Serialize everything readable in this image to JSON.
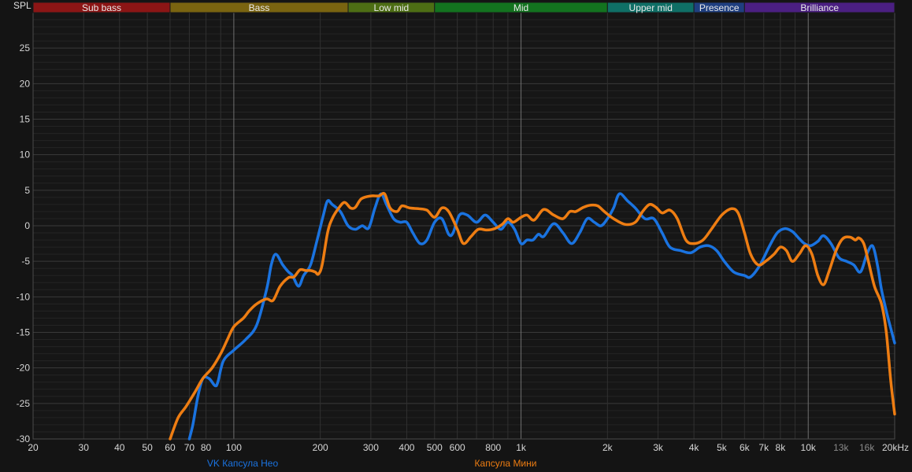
{
  "chart_data": {
    "type": "line",
    "ylabel": "SPL",
    "x_scale": "log",
    "xlim": [
      20,
      20000
    ],
    "ylim": [
      -30,
      30
    ],
    "x_ticks": [
      {
        "v": 20,
        "label": "20"
      },
      {
        "v": 30,
        "label": "30"
      },
      {
        "v": 40,
        "label": "40"
      },
      {
        "v": 50,
        "label": "50"
      },
      {
        "v": 60,
        "label": "60"
      },
      {
        "v": 70,
        "label": "70"
      },
      {
        "v": 80,
        "label": "80"
      },
      {
        "v": 100,
        "label": "100"
      },
      {
        "v": 200,
        "label": "200"
      },
      {
        "v": 300,
        "label": "300"
      },
      {
        "v": 400,
        "label": "400"
      },
      {
        "v": 500,
        "label": "500"
      },
      {
        "v": 600,
        "label": "600"
      },
      {
        "v": 800,
        "label": "800"
      },
      {
        "v": 1000,
        "label": "1k"
      },
      {
        "v": 2000,
        "label": "2k"
      },
      {
        "v": 3000,
        "label": "3k"
      },
      {
        "v": 4000,
        "label": "4k"
      },
      {
        "v": 5000,
        "label": "5k"
      },
      {
        "v": 6000,
        "label": "6k"
      },
      {
        "v": 7000,
        "label": "7k"
      },
      {
        "v": 8000,
        "label": "8k"
      },
      {
        "v": 10000,
        "label": "10k"
      },
      {
        "v": 13000,
        "label": "13k",
        "dim": true
      },
      {
        "v": 16000,
        "label": "16k",
        "dim": true
      },
      {
        "v": 20000,
        "label": "20kHz"
      }
    ],
    "y_ticks": [
      {
        "v": 25,
        "label": "25"
      },
      {
        "v": 20,
        "label": "20"
      },
      {
        "v": 15,
        "label": "15"
      },
      {
        "v": 10,
        "label": "10"
      },
      {
        "v": 5,
        "label": "5"
      },
      {
        "v": 0,
        "label": "0"
      },
      {
        "v": -5,
        "label": "-5"
      },
      {
        "v": -10,
        "label": "-10"
      },
      {
        "v": -15,
        "label": "-15"
      },
      {
        "v": -20,
        "label": "-20"
      },
      {
        "v": -25,
        "label": "-25"
      },
      {
        "v": -30,
        "label": "-30"
      }
    ],
    "bands": [
      {
        "name": "Sub bass",
        "from": 20,
        "to": 60,
        "color": "#8c1515"
      },
      {
        "name": "Bass",
        "from": 60,
        "to": 250,
        "color": "#7a6410"
      },
      {
        "name": "Low mid",
        "from": 250,
        "to": 500,
        "color": "#4d6e14"
      },
      {
        "name": "Mid",
        "from": 500,
        "to": 2000,
        "color": "#13731f"
      },
      {
        "name": "Upper mid",
        "from": 2000,
        "to": 4000,
        "color": "#0f6f66"
      },
      {
        "name": "Presence",
        "from": 4000,
        "to": 6000,
        "color": "#1f3f80"
      },
      {
        "name": "Brilliance",
        "from": 6000,
        "to": 20000,
        "color": "#4b1f82"
      }
    ],
    "grid": true,
    "series": [
      {
        "name": "VK Капсула Нео",
        "color": "#1a73e0",
        "points": [
          [
            70,
            -30
          ],
          [
            72,
            -28
          ],
          [
            75,
            -24
          ],
          [
            78,
            -21.5
          ],
          [
            82,
            -21.5
          ],
          [
            86,
            -22.5
          ],
          [
            88,
            -22
          ],
          [
            92,
            -19
          ],
          [
            100,
            -17.5
          ],
          [
            110,
            -16
          ],
          [
            120,
            -14
          ],
          [
            130,
            -9
          ],
          [
            135,
            -5.5
          ],
          [
            140,
            -4
          ],
          [
            148,
            -5.5
          ],
          [
            155,
            -6.5
          ],
          [
            160,
            -7
          ],
          [
            168,
            -8.5
          ],
          [
            175,
            -7
          ],
          [
            185,
            -5.5
          ],
          [
            195,
            -2
          ],
          [
            205,
            1.5
          ],
          [
            212,
            3.5
          ],
          [
            220,
            3
          ],
          [
            235,
            2
          ],
          [
            250,
            0
          ],
          [
            265,
            -0.5
          ],
          [
            280,
            0
          ],
          [
            295,
            -0.3
          ],
          [
            310,
            2.5
          ],
          [
            325,
            4.5
          ],
          [
            340,
            3
          ],
          [
            360,
            1
          ],
          [
            380,
            0.5
          ],
          [
            400,
            0.5
          ],
          [
            420,
            -1
          ],
          [
            445,
            -2.5
          ],
          [
            470,
            -2
          ],
          [
            500,
            0.5
          ],
          [
            530,
            1
          ],
          [
            560,
            -1.2
          ],
          [
            580,
            -1
          ],
          [
            610,
            1.5
          ],
          [
            650,
            1.5
          ],
          [
            700,
            0.5
          ],
          [
            750,
            1.5
          ],
          [
            800,
            0.5
          ],
          [
            850,
            -0.5
          ],
          [
            900,
            0.5
          ],
          [
            950,
            -0.5
          ],
          [
            1000,
            -2.5
          ],
          [
            1050,
            -2
          ],
          [
            1100,
            -2
          ],
          [
            1150,
            -1.2
          ],
          [
            1200,
            -1.5
          ],
          [
            1300,
            0.3
          ],
          [
            1400,
            -1
          ],
          [
            1500,
            -2.5
          ],
          [
            1600,
            -1
          ],
          [
            1700,
            1
          ],
          [
            1800,
            0.5
          ],
          [
            1900,
            0
          ],
          [
            2000,
            1
          ],
          [
            2100,
            2.5
          ],
          [
            2200,
            4.5
          ],
          [
            2350,
            3.5
          ],
          [
            2500,
            2.5
          ],
          [
            2700,
            1
          ],
          [
            2900,
            1
          ],
          [
            3100,
            -1
          ],
          [
            3300,
            -3
          ],
          [
            3600,
            -3.5
          ],
          [
            3900,
            -3.8
          ],
          [
            4200,
            -3
          ],
          [
            4500,
            -2.8
          ],
          [
            4800,
            -3.5
          ],
          [
            5100,
            -5
          ],
          [
            5500,
            -6.5
          ],
          [
            6000,
            -7
          ],
          [
            6300,
            -7.2
          ],
          [
            6800,
            -5.5
          ],
          [
            7300,
            -3
          ],
          [
            7800,
            -1
          ],
          [
            8300,
            -0.4
          ],
          [
            8800,
            -0.8
          ],
          [
            9300,
            -1.8
          ],
          [
            9700,
            -2.5
          ],
          [
            10200,
            -2.8
          ],
          [
            10800,
            -2.2
          ],
          [
            11300,
            -1.4
          ],
          [
            12000,
            -2.5
          ],
          [
            12800,
            -4.5
          ],
          [
            13600,
            -5
          ],
          [
            14400,
            -5.5
          ],
          [
            15200,
            -6.5
          ],
          [
            16000,
            -4
          ],
          [
            16600,
            -2.8
          ],
          [
            17000,
            -3.5
          ],
          [
            17500,
            -6
          ],
          [
            18000,
            -9
          ],
          [
            18700,
            -12
          ],
          [
            19400,
            -14.5
          ],
          [
            20000,
            -16.5
          ]
        ]
      },
      {
        "name": "Капсула Мини",
        "color": "#ee7d12",
        "points": [
          [
            60,
            -30
          ],
          [
            64,
            -27
          ],
          [
            68,
            -25.5
          ],
          [
            73,
            -23.5
          ],
          [
            78,
            -21.5
          ],
          [
            84,
            -20
          ],
          [
            90,
            -18
          ],
          [
            95,
            -16
          ],
          [
            100,
            -14.2
          ],
          [
            108,
            -13
          ],
          [
            113,
            -12
          ],
          [
            120,
            -11
          ],
          [
            130,
            -10.3
          ],
          [
            137,
            -10.5
          ],
          [
            145,
            -8.5
          ],
          [
            155,
            -7.3
          ],
          [
            162,
            -7.2
          ],
          [
            170,
            -6.2
          ],
          [
            178,
            -6.3
          ],
          [
            185,
            -6.3
          ],
          [
            192,
            -6.5
          ],
          [
            197,
            -6.8
          ],
          [
            203,
            -5.5
          ],
          [
            212,
            -1
          ],
          [
            220,
            1
          ],
          [
            232,
            2.5
          ],
          [
            243,
            3.3
          ],
          [
            255,
            2.5
          ],
          [
            265,
            2.6
          ],
          [
            278,
            3.8
          ],
          [
            300,
            4.2
          ],
          [
            320,
            4.2
          ],
          [
            335,
            4.5
          ],
          [
            350,
            2.5
          ],
          [
            370,
            2
          ],
          [
            385,
            2.8
          ],
          [
            410,
            2.5
          ],
          [
            440,
            2.4
          ],
          [
            470,
            2.2
          ],
          [
            500,
            1.2
          ],
          [
            530,
            2.5
          ],
          [
            560,
            2
          ],
          [
            600,
            -0.5
          ],
          [
            630,
            -2.5
          ],
          [
            670,
            -1.5
          ],
          [
            710,
            -0.5
          ],
          [
            760,
            -0.6
          ],
          [
            810,
            -0.4
          ],
          [
            860,
            0.2
          ],
          [
            900,
            1
          ],
          [
            940,
            0.5
          ],
          [
            1000,
            1.2
          ],
          [
            1050,
            1.5
          ],
          [
            1110,
            0.8
          ],
          [
            1200,
            2.3
          ],
          [
            1300,
            1.5
          ],
          [
            1400,
            1
          ],
          [
            1480,
            2
          ],
          [
            1550,
            2
          ],
          [
            1650,
            2.6
          ],
          [
            1750,
            2.9
          ],
          [
            1850,
            2.8
          ],
          [
            1950,
            2
          ],
          [
            2100,
            1
          ],
          [
            2300,
            0.2
          ],
          [
            2500,
            0.5
          ],
          [
            2650,
            2
          ],
          [
            2800,
            3
          ],
          [
            2950,
            2.6
          ],
          [
            3100,
            1.8
          ],
          [
            3300,
            2.2
          ],
          [
            3500,
            1
          ],
          [
            3750,
            -2
          ],
          [
            4000,
            -2.5
          ],
          [
            4300,
            -2
          ],
          [
            4600,
            -0.5
          ],
          [
            5000,
            1.5
          ],
          [
            5400,
            2.4
          ],
          [
            5700,
            1.8
          ],
          [
            6000,
            -1
          ],
          [
            6300,
            -4
          ],
          [
            6700,
            -5.5
          ],
          [
            7100,
            -5
          ],
          [
            7600,
            -4
          ],
          [
            8000,
            -3
          ],
          [
            8400,
            -3.5
          ],
          [
            8800,
            -5
          ],
          [
            9300,
            -4
          ],
          [
            9800,
            -2.8
          ],
          [
            10300,
            -4
          ],
          [
            10800,
            -7
          ],
          [
            11300,
            -8.3
          ],
          [
            11800,
            -6.5
          ],
          [
            12500,
            -3.5
          ],
          [
            13200,
            -1.8
          ],
          [
            14000,
            -1.6
          ],
          [
            14600,
            -2
          ],
          [
            15000,
            -1.7
          ],
          [
            15600,
            -2.5
          ],
          [
            16200,
            -5
          ],
          [
            17000,
            -8.5
          ],
          [
            18000,
            -11
          ],
          [
            18700,
            -15
          ],
          [
            19400,
            -22
          ],
          [
            20000,
            -26.5
          ]
        ]
      }
    ]
  }
}
